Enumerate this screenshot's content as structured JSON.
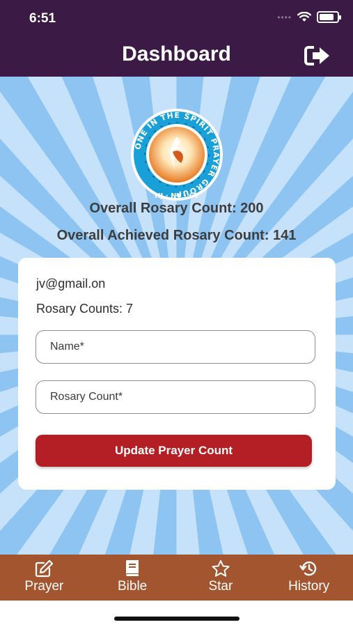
{
  "status": {
    "time": "6:51",
    "dots": "••••",
    "battery_level": 0.85
  },
  "nav": {
    "title": "Dashboard"
  },
  "logo": {
    "ring_text": "ONE IN THE SPIRIT PRAYER GROUP",
    "region_text": "NJ · NY · CT"
  },
  "summary": {
    "overall_rosary": "Overall Rosary Count: 200",
    "overall_achieved": "Overall Achieved Rosary Count: 141"
  },
  "card": {
    "email": "jv@gmail.on",
    "rosary_counts": "Rosary Counts: 7",
    "name_placeholder": "Name*",
    "count_placeholder": "Rosary Count*",
    "update_button": "Update Prayer Count"
  },
  "tabs": [
    {
      "label": "Prayer",
      "icon": "edit-icon"
    },
    {
      "label": "Bible",
      "icon": "book-icon"
    },
    {
      "label": "Star",
      "icon": "star-icon"
    },
    {
      "label": "History",
      "icon": "history-icon"
    }
  ],
  "colors": {
    "header": "#3b1a45",
    "tab_bar": "#a35530",
    "button": "#b31f24",
    "background_ray_light": "#c6e2fb",
    "background_ray_dark": "#8ec4f2"
  }
}
